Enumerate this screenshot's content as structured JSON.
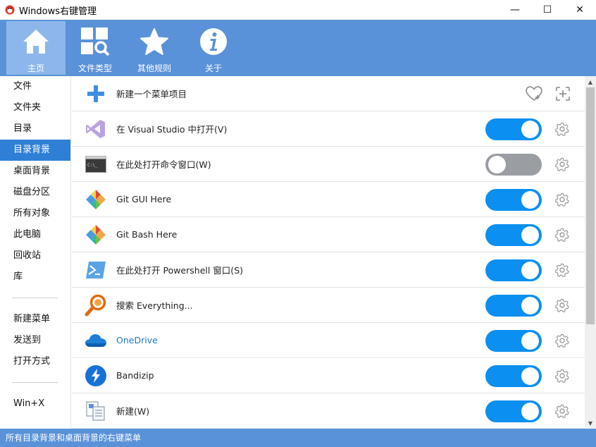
{
  "window": {
    "title": "Windows右键管理",
    "minimize": "—",
    "maximize": "☐",
    "close": "✕"
  },
  "toolbar": {
    "items": [
      {
        "label": "主页",
        "icon": "home-icon",
        "active": true
      },
      {
        "label": "文件类型",
        "icon": "file-types-icon",
        "active": false
      },
      {
        "label": "其他规则",
        "icon": "star-icon",
        "active": false
      },
      {
        "label": "关于",
        "icon": "info-icon",
        "active": false
      }
    ]
  },
  "sidebar": {
    "groups": [
      [
        "文件",
        "文件夹",
        "目录",
        "目录背景",
        "桌面背景",
        "磁盘分区",
        "所有对象",
        "此电脑",
        "回收站",
        "库"
      ],
      [
        "新建菜单",
        "发送到",
        "打开方式"
      ],
      [
        "Win+X"
      ]
    ],
    "selected": "目录背景"
  },
  "list": {
    "new_item_label": "新建一个菜单项目",
    "rows": [
      {
        "label": "在 Visual Studio 中打开(V)",
        "icon": "visual-studio-icon",
        "enabled": true
      },
      {
        "label": "在此处打开命令窗口(W)",
        "icon": "command-prompt-icon",
        "enabled": false
      },
      {
        "label": "Git GUI Here",
        "icon": "git-icon",
        "enabled": true
      },
      {
        "label": "Git Bash Here",
        "icon": "git-icon",
        "enabled": true
      },
      {
        "label": "在此处打开 Powershell 窗口(S)",
        "icon": "powershell-icon",
        "enabled": true
      },
      {
        "label": "搜索 Everything...",
        "icon": "everything-search-icon",
        "enabled": true
      },
      {
        "label": "OneDrive",
        "icon": "onedrive-icon",
        "enabled": true
      },
      {
        "label": "Bandizip",
        "icon": "bandizip-icon",
        "enabled": true
      },
      {
        "label": "新建(W)",
        "icon": "new-document-icon",
        "enabled": true
      }
    ]
  },
  "status": {
    "text": "所有目录背景和桌面背景的右键菜单"
  },
  "colors": {
    "accent": "#5a92d9",
    "selected": "#2f7fd6",
    "toggle_on": "#0b8ff0",
    "toggle_off": "#9a9ea3"
  }
}
